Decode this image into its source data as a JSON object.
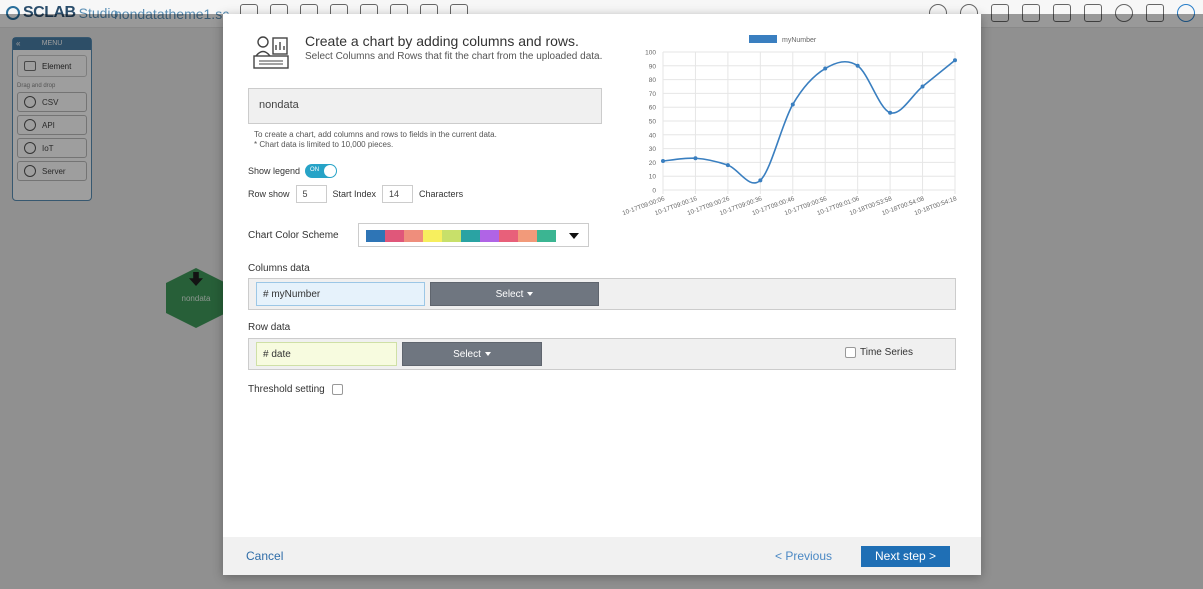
{
  "app": {
    "brand": "SCLAB",
    "studio": "Studio",
    "project_title": "nondatatheme1.sc..."
  },
  "menu": {
    "header": "MENU",
    "element_label": "Element",
    "drag_label": "Drag and drop",
    "items": [
      "CSV",
      "API",
      "IoT",
      "Server"
    ]
  },
  "canvas": {
    "node_label": "nondata"
  },
  "modal": {
    "title": "Create a chart by adding columns and rows.",
    "subtitle": "Select Columns and Rows that fit the chart from the uploaded data.",
    "data_name": "nondata",
    "note_line1": "To create a chart, add columns and rows to fields in the current data.",
    "note_line2": "* Chart data is limited to 10,000 pieces.",
    "show_legend_label": "Show legend",
    "toggle_text": "ON",
    "row_show_label": "Row show",
    "row_show_value": "5",
    "start_index_label": "Start Index",
    "start_index_value": "14",
    "characters_label": "Characters",
    "color_scheme_label": "Chart Color Scheme",
    "color_scheme": [
      "#2e75b6",
      "#e0577a",
      "#ef8e7c",
      "#f7ef5e",
      "#c8e06a",
      "#2aa3a3",
      "#b064e6",
      "#e8607a",
      "#f29a7a",
      "#3bb592"
    ],
    "columns_label": "Columns data",
    "column_value": "# myNumber",
    "select_label": "Select",
    "rows_label": "Row data",
    "row_value": "# date",
    "time_series_label": "Time Series",
    "threshold_label": "Threshold setting",
    "cancel_label": "Cancel",
    "previous_label": "< Previous",
    "next_label": "Next step >"
  },
  "chart_data": {
    "type": "line",
    "legend": "myNumber",
    "legend_position": "top",
    "series_color": "#3a7fc0",
    "ylim": [
      0,
      100
    ],
    "yticks": [
      0,
      10,
      20,
      30,
      40,
      50,
      60,
      70,
      80,
      90,
      100
    ],
    "grid": true,
    "categories": [
      "10-17T09:00:06",
      "10-17T09:00:16",
      "10-17T09:00:26",
      "10-17T09:00:36",
      "10-17T09:00:46",
      "10-17T09:00:56",
      "10-17T09:01:06",
      "10-18T00:53:58",
      "10-18T00:54:08",
      "10-18T00:54:18"
    ],
    "series": [
      {
        "name": "myNumber",
        "values": [
          21,
          23,
          18,
          7,
          62,
          88,
          90,
          56,
          75,
          94
        ]
      }
    ]
  }
}
